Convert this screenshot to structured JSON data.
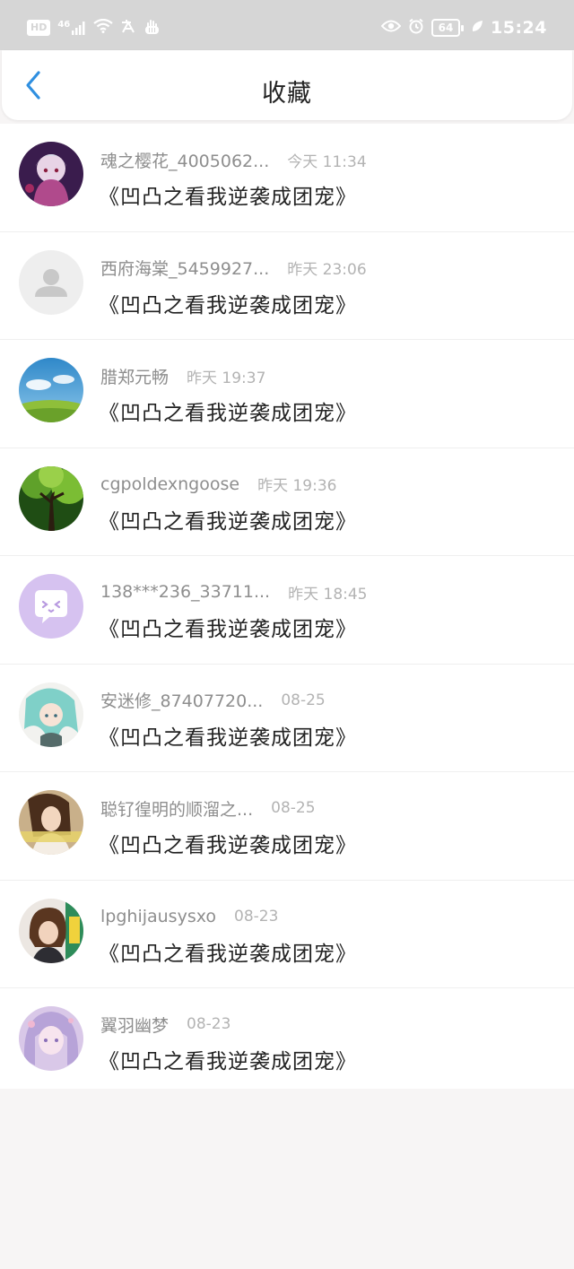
{
  "status_bar": {
    "hd_label": "HD",
    "network_label": "46",
    "battery_level": "64",
    "time": "15:24"
  },
  "header": {
    "title": "收藏",
    "back_icon": "chevron-left-icon",
    "accent_color": "#2f8fe0"
  },
  "favorites": [
    {
      "username": "魂之樱花_4005062...",
      "time": "今天 11:34",
      "book": "《凹凸之看我逆袭成团宠》",
      "avatar": "anime-girl-dark"
    },
    {
      "username": "西府海棠_5459927...",
      "time": "昨天 23:06",
      "book": "《凹凸之看我逆袭成团宠》",
      "avatar": "default-person"
    },
    {
      "username": "腊郑元畅",
      "time": "昨天 19:37",
      "book": "《凹凸之看我逆袭成团宠》",
      "avatar": "sky-field"
    },
    {
      "username": "cgpoldexngoose",
      "time": "昨天 19:36",
      "book": "《凹凸之看我逆袭成团宠》",
      "avatar": "green-tree"
    },
    {
      "username": "138***236_33711...",
      "time": "昨天 18:45",
      "book": "《凹凸之看我逆袭成团宠》",
      "avatar": "purple-chat"
    },
    {
      "username": "安迷修_87407720...",
      "time": "08-25",
      "book": "《凹凸之看我逆袭成团宠》",
      "avatar": "anime-teal"
    },
    {
      "username": "聪钌徨明的顺溜之...",
      "time": "08-25",
      "book": "《凹凸之看我逆袭成团宠》",
      "avatar": "girl-photo"
    },
    {
      "username": "lpghijausysxo",
      "time": "08-23",
      "book": "《凹凸之看我逆袭成团宠》",
      "avatar": "short-hair-girl"
    },
    {
      "username": "翼羽幽梦",
      "time": "08-23",
      "book": "《凹凸之看我逆袭成团宠》",
      "avatar": "anime-pink"
    }
  ]
}
